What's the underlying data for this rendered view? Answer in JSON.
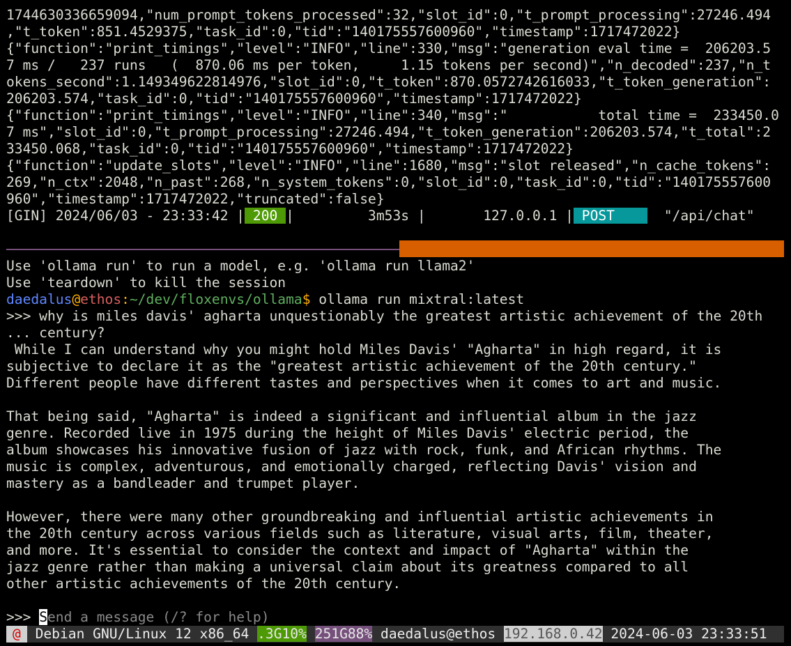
{
  "log": {
    "lines": [
      "1744630336659094,\"num_prompt_tokens_processed\":32,\"slot_id\":0,\"t_prompt_processing\":27246.494",
      ",\"t_token\":851.4529375,\"task_id\":0,\"tid\":\"140175557600960\",\"timestamp\":1717472022}",
      "{\"function\":\"print_timings\",\"level\":\"INFO\",\"line\":330,\"msg\":\"generation eval time =  206203.5",
      "7 ms /   237 runs   (  870.06 ms per token,     1.15 tokens per second)\",\"n_decoded\":237,\"n_t",
      "okens_second\":1.14934962281497​6,\"slot_id\":0,\"t_token\":870.0572742616033,\"t_token_generation\":",
      "206203.574,\"task_id\":0,\"tid\":\"140175557600960\",\"timestamp\":1717472022}",
      "{\"function\":\"print_timings\",\"level\":\"INFO\",\"line\":340,\"msg\":\"           total time =  233450.0",
      "7 ms\",\"slot_id\":0,\"t_prompt_processing\":27246.494,\"t_token_generation\":206203.574,\"t_total\":2",
      "33450.068,\"task_id\":0,\"tid\":\"140175557600960\",\"timestamp\":1717472022}",
      "{\"function\":\"update_slots\",\"level\":\"INFO\",\"line\":1680,\"msg\":\"slot released\",\"n_cache_tokens\":",
      "269,\"n_ctx\":2048,\"n_past\":268,\"n_system_tokens\":0,\"slot_id\":0,\"task_id\":0,\"tid\":\"140175557600",
      "960\",\"timestamp\":1717472022,\"truncated\":false}"
    ],
    "gin": {
      "prefix": "[GIN] 2024/06/03 - 23:33:42 |",
      "status": " 200 ",
      "latency": "|         3m53s |       127.0.0.1 |",
      "method": " POST    ",
      "path": "  \"/api/chat\""
    }
  },
  "session": {
    "hint1": "Use 'ollama run' to run a model, e.g. 'ollama run llama2'",
    "hint2": "Use 'teardown' to kill the session",
    "prompt": {
      "user": "daedalus",
      "at": "@",
      "host": "ethos",
      "colon": ":",
      "path": "~/dev/floxenvs/ollama",
      "dollar": "$",
      "command": " ollama run mixtral:latest"
    },
    "question_lines": [
      ">>> why is miles davis' agharta unquestionably the greatest artistic achievement of the 20th",
      "... century?"
    ],
    "response_paragraphs": [
      [
        " While I can understand why you might hold Miles Davis' \"Agharta\" in high regard, it is",
        "subjective to declare it as the \"greatest artistic achievement of the 20th century.\"",
        "Different people have different tastes and perspectives when it comes to art and music."
      ],
      [
        "That being said, \"Agharta\" is indeed a significant and influential album in the jazz",
        "genre. Recorded live in 1975 during the height of Miles Davis' electric period, the",
        "album showcases his innovative fusion of jazz with rock, funk, and African rhythms. The",
        "music is complex, adventurous, and emotionally charged, reflecting Davis' vision and",
        "mastery as a bandleader and trumpet player."
      ],
      [
        "However, there were many other groundbreaking and influential artistic achievements in",
        "the 20th century across various fields such as literature, visual arts, film, theater,",
        "and more. It's essential to consider the context and impact of \"Agharta\" within the",
        "jazz genre rather than making a universal claim about its greatness compared to all",
        "other artistic achievements of the 20th century."
      ]
    ],
    "input": {
      "prompt": ">>> ",
      "cursor_char": "S",
      "placeholder": "end a message (/? for help)"
    }
  },
  "statusbar": {
    "logo": "@",
    "os": " Debian GNU/Linux 12 x86_64 ",
    "mem": ".3G10%",
    "disk": "251G88%",
    "user_host": " daedalus@ethos ",
    "ip": "192.168.0.42",
    "datetime": " 2024-06-03 23:33:51"
  },
  "colors": {
    "status_ok": "#4e9a06",
    "method_post": "#06989a",
    "divider": "#75507b",
    "tmux_pane_active": "#d75f00"
  }
}
